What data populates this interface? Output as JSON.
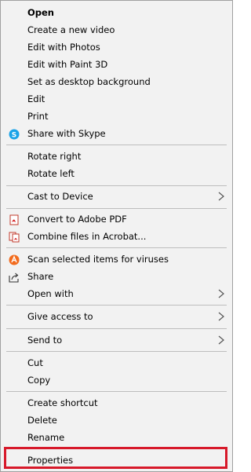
{
  "menu": {
    "items": [
      {
        "label": "Open"
      },
      {
        "label": "Create a new video"
      },
      {
        "label": "Edit with Photos"
      },
      {
        "label": "Edit with Paint 3D"
      },
      {
        "label": "Set as desktop background"
      },
      {
        "label": "Edit"
      },
      {
        "label": "Print"
      },
      {
        "label": "Share with Skype",
        "icon": "skype-icon"
      },
      {
        "label": "Rotate right"
      },
      {
        "label": "Rotate left"
      },
      {
        "label": "Cast to Device",
        "icon": "submenu-arrow-icon"
      },
      {
        "label": "Convert to Adobe PDF",
        "icon": "adobe-pdf-icon"
      },
      {
        "label": "Combine files in Acrobat...",
        "icon": "adobe-pdf-icon"
      },
      {
        "label": "Scan selected items for viruses",
        "icon": "avast-icon"
      },
      {
        "label": "Share",
        "icon": "share-icon"
      },
      {
        "label": "Open with",
        "icon": "submenu-arrow-icon"
      },
      {
        "label": "Give access to",
        "icon": "submenu-arrow-icon"
      },
      {
        "label": "Send to",
        "icon": "submenu-arrow-icon"
      },
      {
        "label": "Cut"
      },
      {
        "label": "Copy"
      },
      {
        "label": "Create shortcut"
      },
      {
        "label": "Delete"
      },
      {
        "label": "Rename"
      },
      {
        "label": "Properties"
      }
    ]
  },
  "colors": {
    "highlight_border": "#d7192a",
    "separator": "#bdbdbd",
    "menu_background": "#f2f2f2"
  }
}
